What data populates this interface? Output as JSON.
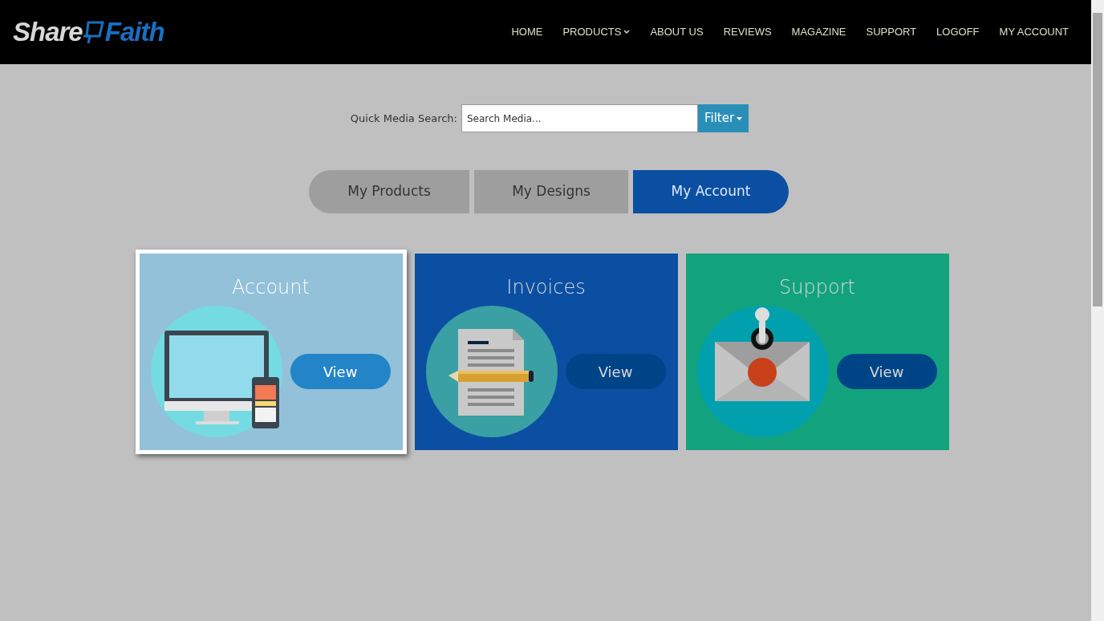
{
  "header": {
    "logo": {
      "first": "Share",
      "second": "Faith"
    },
    "nav": [
      {
        "label": "HOME",
        "dropdown": false
      },
      {
        "label": "PRODUCTS",
        "dropdown": true
      },
      {
        "label": "ABOUT US",
        "dropdown": false
      },
      {
        "label": "REVIEWS",
        "dropdown": false
      },
      {
        "label": "MAGAZINE",
        "dropdown": false
      },
      {
        "label": "SUPPORT",
        "dropdown": false
      },
      {
        "label": "LOGOFF",
        "dropdown": false
      },
      {
        "label": "MY ACCOUNT",
        "dropdown": false
      }
    ]
  },
  "search": {
    "label": "Quick Media Search:",
    "placeholder": "Search Media...",
    "filter": "Filter"
  },
  "tabs": [
    {
      "label": "My Products",
      "selected": false
    },
    {
      "label": "My Designs",
      "selected": false
    },
    {
      "label": "My Account",
      "selected": true
    }
  ],
  "cards": [
    {
      "title": "Account",
      "kind": "computer",
      "color": "#93c1d9",
      "selected": true,
      "button": "View"
    },
    {
      "title": "Invoices",
      "kind": "document",
      "color": "#0b4fa3",
      "selected": false,
      "button": "View"
    },
    {
      "title": "Support",
      "kind": "envelope",
      "color": "#12a37e",
      "selected": false,
      "button": "View"
    }
  ]
}
